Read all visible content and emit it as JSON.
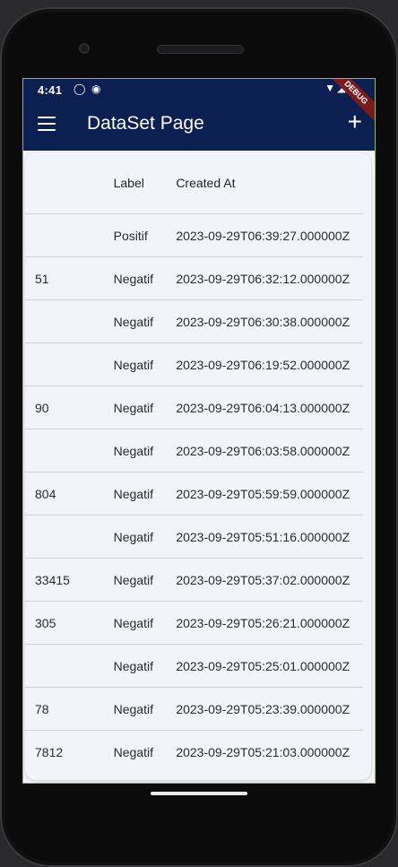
{
  "status_bar": {
    "time": "4:41",
    "icon1": "◯",
    "icon2": "◉",
    "right": "▼◢▮"
  },
  "app_bar": {
    "title": "DataSet Page",
    "add_symbol": "+",
    "debug_label": "DEBUG"
  },
  "table": {
    "headers": [
      "",
      "Label",
      "Created At"
    ],
    "rows": [
      {
        "text": "",
        "label": "Positif",
        "created_at": "2023-09-29T06:39:27.000000Z"
      },
      {
        "text": "51",
        "label": "Negatif",
        "created_at": "2023-09-29T06:32:12.000000Z"
      },
      {
        "text": "",
        "label": "Negatif",
        "created_at": "2023-09-29T06:30:38.000000Z"
      },
      {
        "text": "",
        "label": "Negatif",
        "created_at": "2023-09-29T06:19:52.000000Z"
      },
      {
        "text": "90",
        "label": "Negatif",
        "created_at": "2023-09-29T06:04:13.000000Z"
      },
      {
        "text": "",
        "label": "Negatif",
        "created_at": "2023-09-29T06:03:58.000000Z"
      },
      {
        "text": "804",
        "label": "Negatif",
        "created_at": "2023-09-29T05:59:59.000000Z"
      },
      {
        "text": "",
        "label": "Negatif",
        "created_at": "2023-09-29T05:51:16.000000Z"
      },
      {
        "text": "33415",
        "label": "Negatif",
        "created_at": "2023-09-29T05:37:02.000000Z"
      },
      {
        "text": "305",
        "label": "Negatif",
        "created_at": "2023-09-29T05:26:21.000000Z"
      },
      {
        "text": "",
        "label": "Negatif",
        "created_at": "2023-09-29T05:25:01.000000Z"
      },
      {
        "text": "78",
        "label": "Negatif",
        "created_at": "2023-09-29T05:23:39.000000Z"
      },
      {
        "text": "7812",
        "label": "Negatif",
        "created_at": "2023-09-29T05:21:03.000000Z"
      }
    ]
  },
  "colors": {
    "app_bar": "#0b1f51",
    "background": "#f3f3fa",
    "debug_ribbon": "#7a1b1b"
  }
}
